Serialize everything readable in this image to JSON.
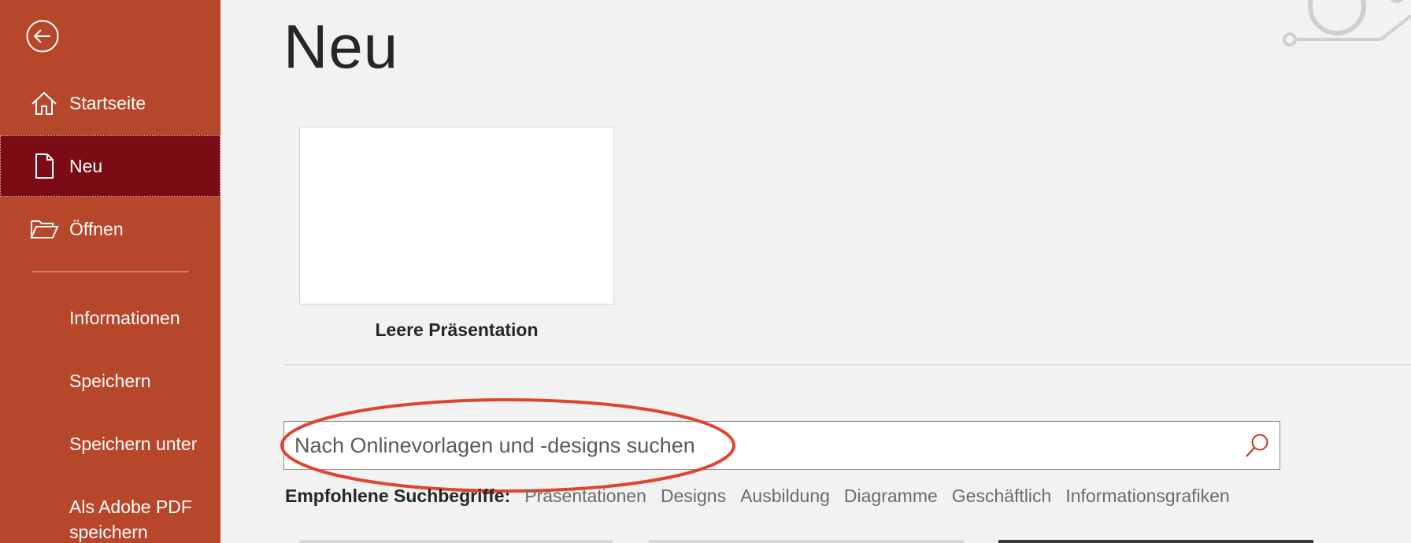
{
  "sidebar": {
    "back_icon": "back-arrow-circle-icon",
    "nav": [
      {
        "label": "Startseite",
        "icon": "home-icon"
      },
      {
        "label": "Neu",
        "icon": "new-document-icon",
        "active": true
      },
      {
        "label": "Öffnen",
        "icon": "open-folder-icon"
      }
    ],
    "items": [
      {
        "label": "Informationen"
      },
      {
        "label": "Speichern"
      },
      {
        "label": "Speichern unter"
      },
      {
        "label_line1": "Als Adobe PDF",
        "label_line2": "speichern"
      }
    ],
    "colors": {
      "background": "#b7472a",
      "active": "#7b0c15"
    }
  },
  "main": {
    "title": "Neu",
    "templates": [
      {
        "caption": "Leere Präsentation"
      }
    ],
    "search": {
      "placeholder": "Nach Onlinevorlagen und -designs suchen",
      "value": "",
      "icon": "search-icon"
    },
    "suggestions": {
      "label": "Empfohlene Suchbegriffe:",
      "items": [
        "Präsentationen",
        "Designs",
        "Ausbildung",
        "Diagramme",
        "Geschäftlich",
        "Informationsgrafiken"
      ]
    },
    "annotation_color": "#e0442e"
  }
}
